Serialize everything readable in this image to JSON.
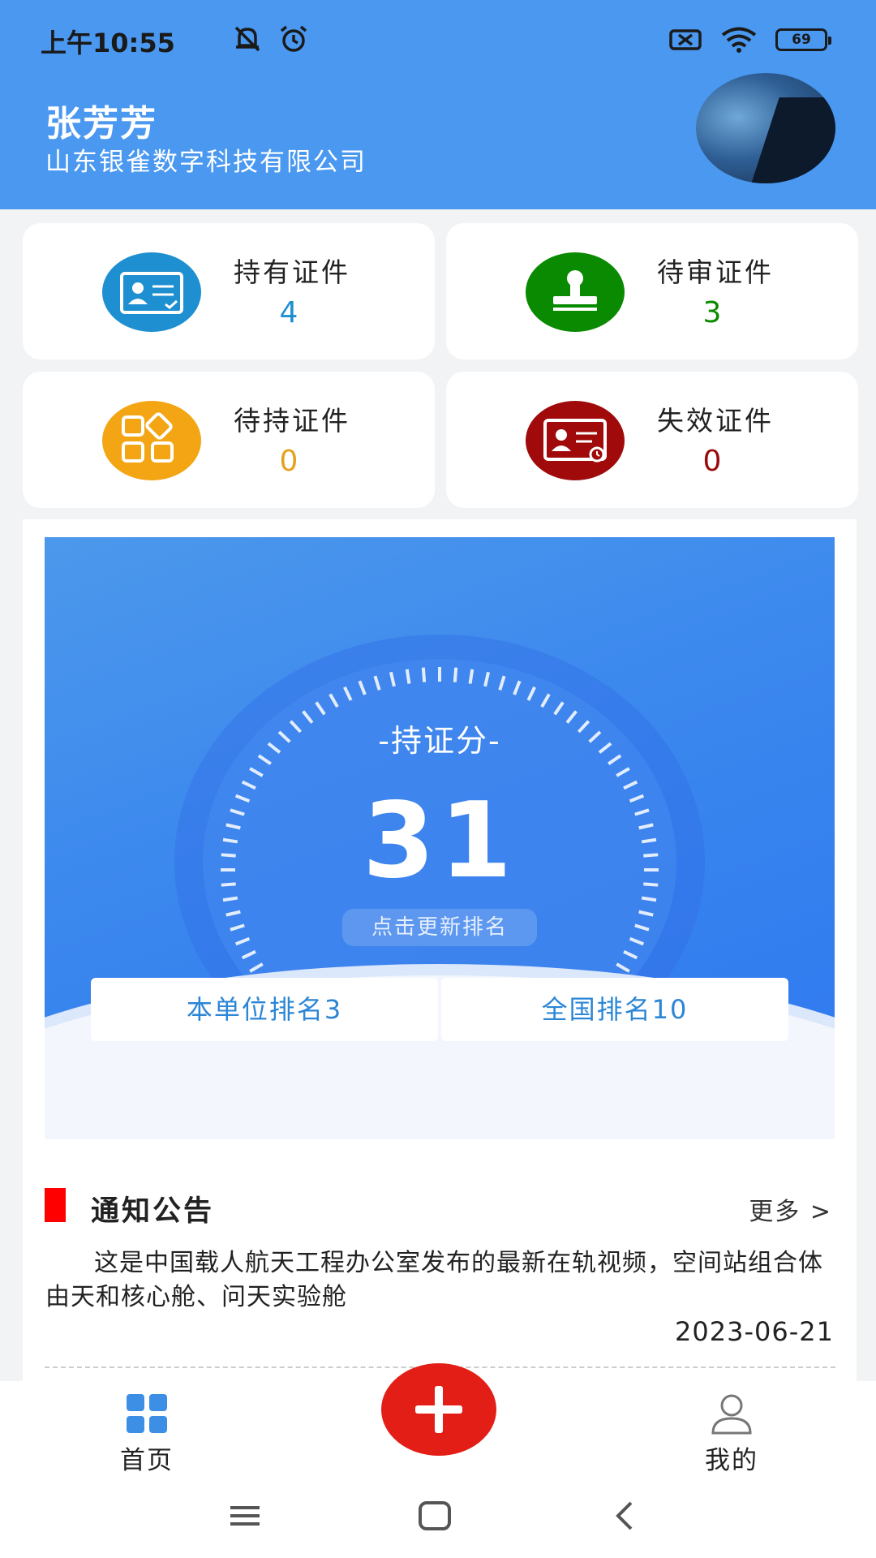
{
  "status_bar": {
    "time": "上午10:55",
    "battery": "69"
  },
  "header": {
    "user_name": "张芳芳",
    "company": "山东银雀数字科技有限公司"
  },
  "cards": [
    {
      "title": "持有证件",
      "value": "4",
      "color": "#1e8fd0",
      "icon": "id-card-icon"
    },
    {
      "title": "待审证件",
      "value": "3",
      "color": "#098a00",
      "icon": "stamp-icon"
    },
    {
      "title": "待持证件",
      "value": "0",
      "color": "#e6a01c",
      "icon": "apps-icon"
    },
    {
      "title": "失效证件",
      "value": "0",
      "color": "#9a0b0b",
      "icon": "expired-card-icon"
    }
  ],
  "score": {
    "label": "-持证分-",
    "value": "31",
    "refresh_label": "点击更新排名",
    "unit_rank_label": "本单位排名3",
    "national_rank_label": "全国排名10"
  },
  "notice": {
    "title": "通知公告",
    "more_label": "更多 >",
    "text": "这是中国载人航天工程办公室发布的最新在轨视频，空间站组合体由天和核心舱、问天实验舱",
    "date": "2023-06-21"
  },
  "bottom_nav": {
    "home_label": "首页",
    "mine_label": "我的"
  },
  "colors": {
    "header": "#4a98f0",
    "accent_red": "#e31e16",
    "link_blue": "#2b86d6"
  }
}
